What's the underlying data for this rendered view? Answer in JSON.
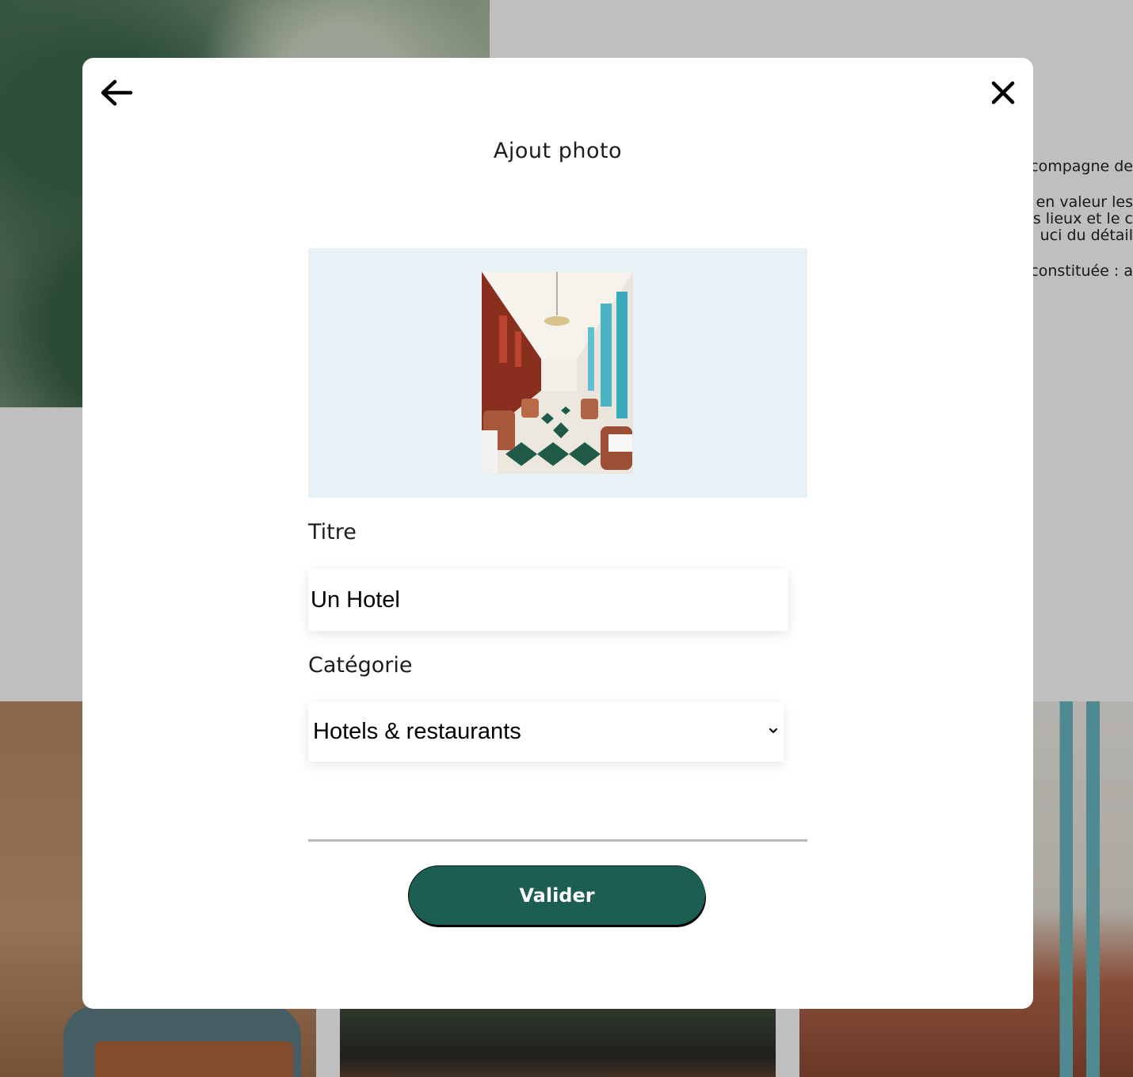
{
  "background": {
    "text_lines": [
      [
        "compagne de"
      ],
      [
        "en valeur les",
        "s lieux et le c",
        "uci du détail"
      ],
      [
        "constituée : a"
      ]
    ]
  },
  "modal": {
    "title": "Ajout photo",
    "back_icon": "arrow-left-icon",
    "close_icon": "close-icon",
    "photo_alt": "Hotel restaurant interior photo"
  },
  "form": {
    "title_label": "Titre",
    "title_value": "Un Hotel",
    "category_label": "Catégorie",
    "category_value": "Hotels & restaurants",
    "submit_label": "Valider"
  },
  "colors": {
    "accent": "#1d5e52",
    "photo_area": "#e8f1f6"
  }
}
